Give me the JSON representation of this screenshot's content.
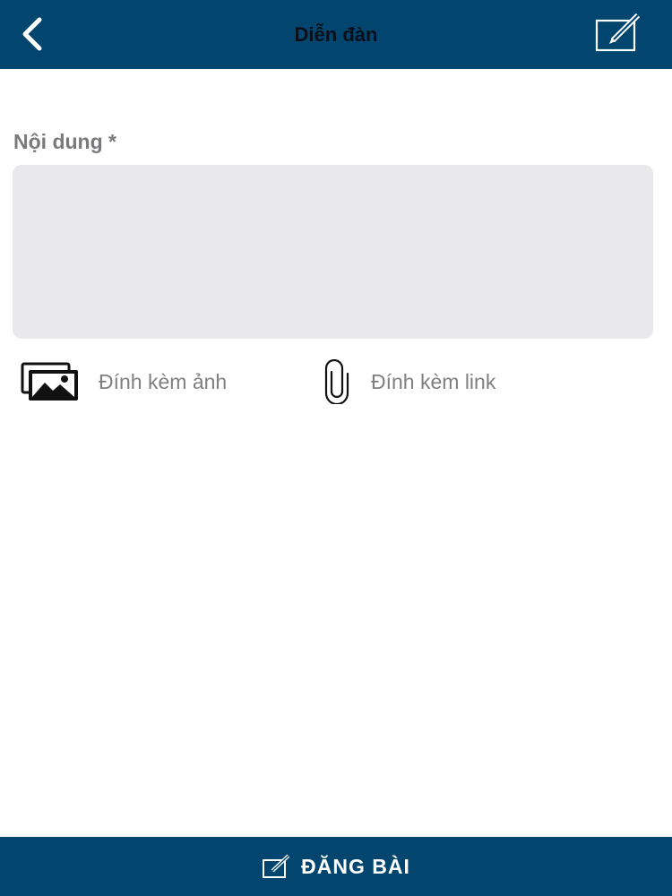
{
  "header": {
    "title": "Diễn đàn",
    "back_icon": "chevron-left-icon",
    "compose_icon": "edit-icon"
  },
  "form": {
    "content_label": "Nội dung *",
    "content_value": "",
    "content_placeholder": ""
  },
  "attachments": {
    "image_label": "Đính kèm ảnh",
    "image_icon": "images-icon",
    "link_label": "Đính kèm link",
    "link_icon": "paperclip-icon"
  },
  "footer": {
    "submit_label": "ĐĂNG BÀI",
    "submit_icon": "edit-icon"
  },
  "colors": {
    "bar_background": "#02466f",
    "input_background": "#e9e8ea",
    "label_gray": "#7a7a7c"
  }
}
